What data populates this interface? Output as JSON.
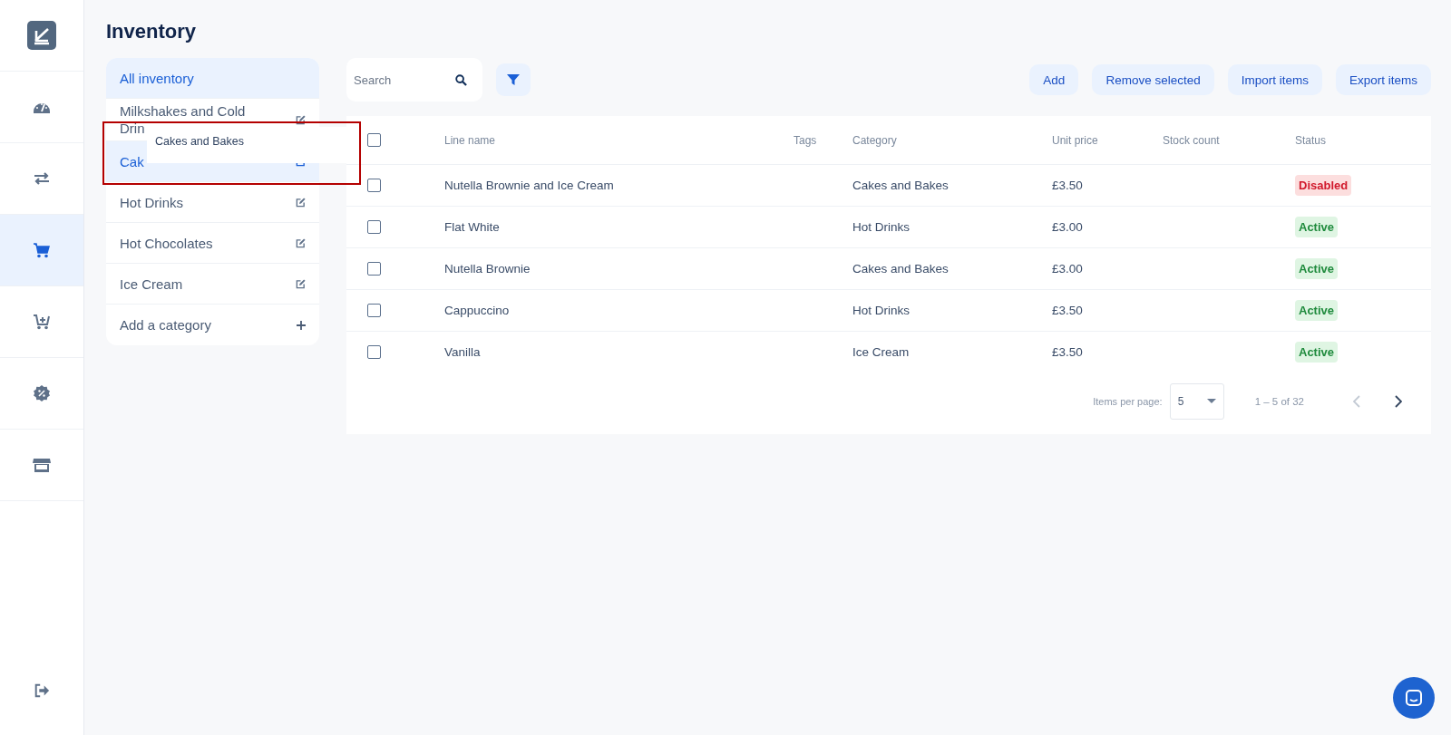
{
  "sidebar": {
    "nav": [
      {
        "selected": false
      },
      {
        "selected": false
      },
      {
        "selected": true
      },
      {
        "selected": false
      },
      {
        "selected": false
      },
      {
        "selected": false
      }
    ]
  },
  "page_title": "Inventory",
  "categories": [
    {
      "label": "All inventory",
      "kind": "all",
      "selected": true
    },
    {
      "label": "Milkshakes and Cold Drin",
      "kind": "category",
      "selected": false
    },
    {
      "label": "Cak",
      "kind": "category",
      "selected": true
    },
    {
      "label": "Hot Drinks",
      "kind": "category",
      "selected": false
    },
    {
      "label": "Hot Chocolates",
      "kind": "category",
      "selected": false
    },
    {
      "label": "Ice Cream",
      "kind": "category",
      "selected": false
    },
    {
      "label": "Add a category",
      "kind": "add",
      "selected": false
    }
  ],
  "drag_ghost": {
    "label": "Cakes and Bakes"
  },
  "highlight_frame": true,
  "search": {
    "placeholder": "Search"
  },
  "actions": [
    "Add",
    "Remove selected",
    "Import items",
    "Export items"
  ],
  "table": {
    "header_checked": false,
    "columns": [
      "Line name",
      "Tags",
      "Category",
      "Unit price",
      "Stock count",
      "Status"
    ],
    "rows": [
      {
        "checked": false,
        "name": "Nutella Brownie and Ice Cream",
        "category": "Cakes and Bakes",
        "price": "£3.50",
        "status": "Disabled",
        "active": false
      },
      {
        "checked": false,
        "name": "Flat White",
        "category": "Hot Drinks",
        "price": "£3.00",
        "status": "Active",
        "active": true
      },
      {
        "checked": false,
        "name": "Nutella Brownie",
        "category": "Cakes and Bakes",
        "price": "£3.00",
        "status": "Active",
        "active": true
      },
      {
        "checked": false,
        "name": "Cappuccino",
        "category": "Hot Drinks",
        "price": "£3.50",
        "status": "Active",
        "active": true
      },
      {
        "checked": false,
        "name": "Vanilla",
        "category": "Ice Cream",
        "price": "£3.50",
        "status": "Active",
        "active": true
      }
    ]
  },
  "pagination": {
    "label": "Items per page:",
    "per_page": "5",
    "range": "1 – 5 of 32",
    "prev_disabled": true,
    "next_disabled": false
  }
}
